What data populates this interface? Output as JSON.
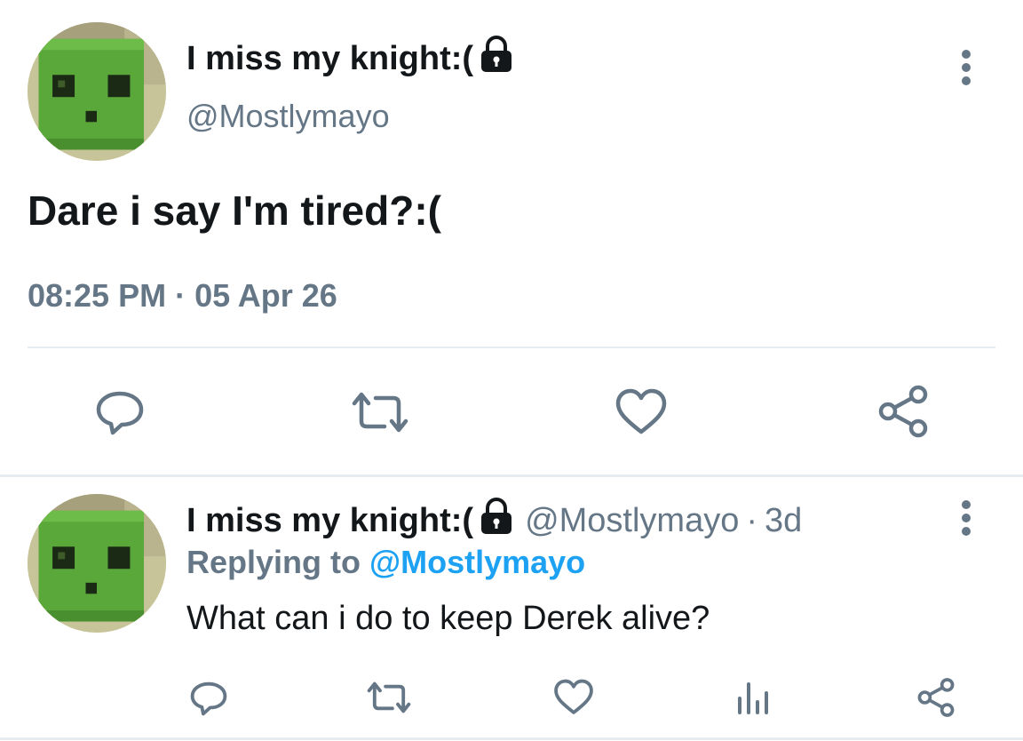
{
  "main_tweet": {
    "author": {
      "name": "I miss my knight:(",
      "handle": "@Mostlymayo",
      "protected_icon": "lock-icon",
      "avatar": "green-slime-avatar"
    },
    "text": "Dare i say I'm tired?:(",
    "timestamp": "08:25 PM · 05 Apr 26",
    "more_icon": "vertical-dots-icon",
    "actions": [
      {
        "name": "reply",
        "icon": "reply-bubble-icon"
      },
      {
        "name": "retweet",
        "icon": "retweet-icon"
      },
      {
        "name": "like",
        "icon": "heart-icon"
      },
      {
        "name": "share",
        "icon": "share-icon"
      }
    ]
  },
  "reply_tweet": {
    "author": {
      "name": "I miss my knight:(",
      "handle": "@Mostlymayo",
      "protected_icon": "lock-icon",
      "avatar": "green-slime-avatar"
    },
    "separator": "·",
    "age": "3d",
    "replying_prefix": "Replying to",
    "replying_to": "@Mostlymayo",
    "text": "What can i do to keep Derek alive?",
    "more_icon": "vertical-dots-icon",
    "actions": [
      {
        "name": "reply",
        "icon": "reply-bubble-icon"
      },
      {
        "name": "retweet",
        "icon": "retweet-icon"
      },
      {
        "name": "like",
        "icon": "heart-icon"
      },
      {
        "name": "analytics",
        "icon": "bar-chart-icon"
      },
      {
        "name": "share",
        "icon": "share-icon"
      }
    ]
  },
  "colors": {
    "primary_text": "#14171a",
    "secondary_text": "#657786",
    "link": "#1da1f2",
    "divider": "#e6ecf0",
    "icon": "#657786"
  }
}
